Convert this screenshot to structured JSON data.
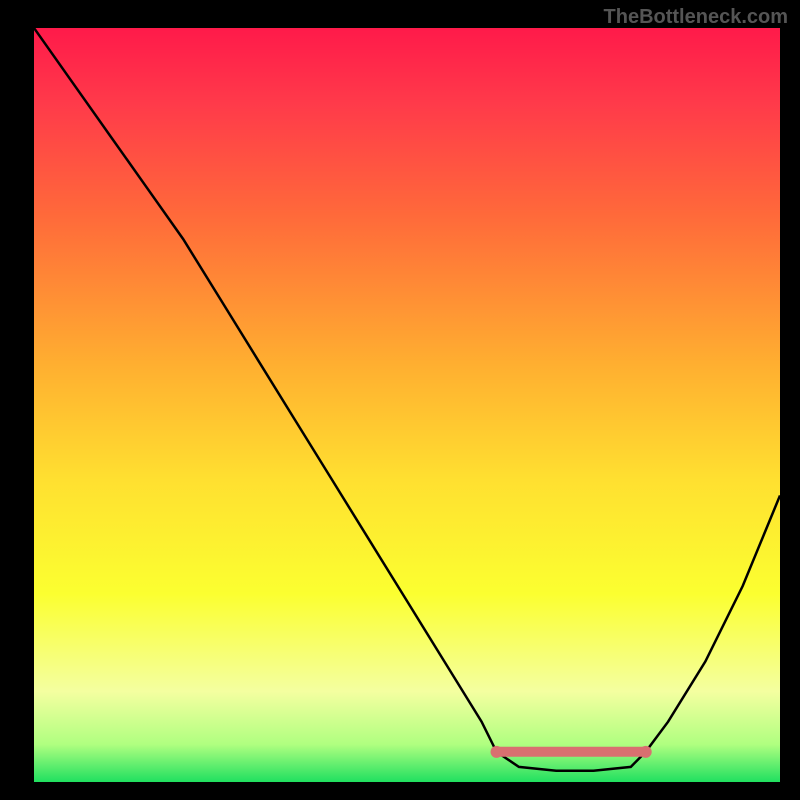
{
  "watermark": "TheBottleneck.com",
  "chart_data": {
    "type": "line",
    "title": "",
    "xlabel": "",
    "ylabel": "",
    "xlim": [
      0,
      100
    ],
    "ylim": [
      0,
      100
    ],
    "series": [
      {
        "name": "curve",
        "x": [
          0,
          5,
          10,
          15,
          20,
          25,
          30,
          35,
          40,
          45,
          50,
          55,
          60,
          62,
          65,
          70,
          75,
          80,
          82,
          85,
          90,
          95,
          100
        ],
        "y": [
          100,
          93,
          86,
          79,
          72,
          64,
          56,
          48,
          40,
          32,
          24,
          16,
          8,
          4,
          2,
          1.5,
          1.5,
          2,
          4,
          8,
          16,
          26,
          38
        ]
      },
      {
        "name": "marker-band",
        "x": [
          62,
          65,
          70,
          75,
          80,
          82
        ],
        "y": [
          4,
          4,
          4,
          4,
          4,
          4
        ]
      }
    ],
    "gradient_stops": [
      {
        "pos": 0.0,
        "color": "#ff1a4a"
      },
      {
        "pos": 0.1,
        "color": "#ff3a4a"
      },
      {
        "pos": 0.25,
        "color": "#ff6a3a"
      },
      {
        "pos": 0.45,
        "color": "#ffb030"
      },
      {
        "pos": 0.6,
        "color": "#ffe030"
      },
      {
        "pos": 0.75,
        "color": "#fbff30"
      },
      {
        "pos": 0.88,
        "color": "#f4ffa0"
      },
      {
        "pos": 0.95,
        "color": "#b0ff80"
      },
      {
        "pos": 1.0,
        "color": "#20e060"
      }
    ],
    "marker_color": "#d97070"
  }
}
